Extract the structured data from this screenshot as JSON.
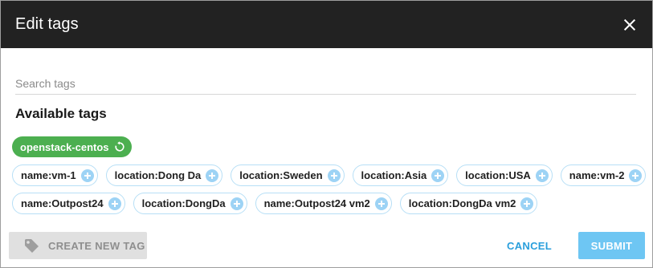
{
  "dialog": {
    "title": "Edit tags",
    "close_icon": "close-icon"
  },
  "search": {
    "placeholder": "Search tags",
    "value": ""
  },
  "available_tags": {
    "heading": "Available tags",
    "active": [
      {
        "label": "openstack-centos",
        "icon": "reset-icon",
        "color": "#4caf50"
      }
    ],
    "items": [
      {
        "label": "name:vm-1"
      },
      {
        "label": "location:Dong Da"
      },
      {
        "label": "location:Sweden"
      },
      {
        "label": "location:Asia"
      },
      {
        "label": "location:USA"
      },
      {
        "label": "name:vm-2"
      },
      {
        "label": "name:Outpost24"
      },
      {
        "label": "location:DongDa"
      },
      {
        "label": "name:Outpost24 vm2"
      },
      {
        "label": "location:DongDa vm2"
      }
    ],
    "add_icon": "plus-icon"
  },
  "footer": {
    "create_label": "CREATE NEW TAG",
    "create_icon": "tag-icon",
    "cancel_label": "CANCEL",
    "submit_label": "SUBMIT"
  },
  "colors": {
    "header_bg": "#222222",
    "accent": "#2a9fdc",
    "submit_bg": "#6ec6f3",
    "active_tag": "#4caf50",
    "chip_border": "#b7dff6"
  }
}
